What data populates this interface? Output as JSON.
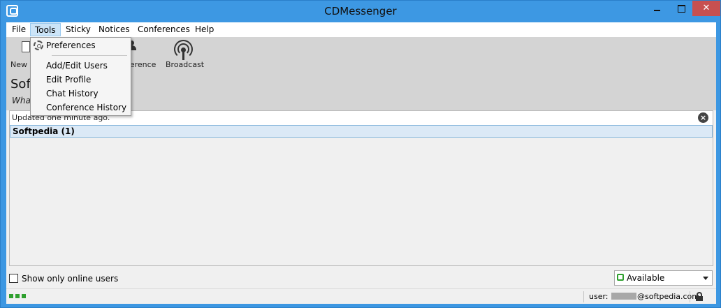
{
  "window": {
    "title": "CDMessenger"
  },
  "menubar": {
    "items": [
      {
        "label": "File"
      },
      {
        "label": "Tools"
      },
      {
        "label": "Sticky"
      },
      {
        "label": "Notices"
      },
      {
        "label": "Conferences"
      },
      {
        "label": "Help"
      }
    ],
    "active": "Tools"
  },
  "tools_menu": {
    "items": [
      {
        "label": "Preferences",
        "icon": "gear-icon"
      },
      {
        "label": "Add/Edit Users"
      },
      {
        "label": "Edit Profile"
      },
      {
        "label": "Chat History"
      },
      {
        "label": "Conference History"
      }
    ]
  },
  "toolbar": {
    "new_label_partial": "New S",
    "conference_label_partial": "nference",
    "broadcast_label": "Broadcast"
  },
  "profile": {
    "name_partial": "Soft",
    "status_partial": "What"
  },
  "users_panel": {
    "updated_text": "Updated one minute ago.",
    "group_label": "Softpedia (1)"
  },
  "footer": {
    "show_online_label": "Show only online users",
    "show_online_checked": false,
    "status_value": "Available",
    "user_prefix": "user:",
    "user_domain": "@softpedia.com"
  },
  "colors": {
    "titlebar": "#3d98e3",
    "close_button": "#c75050",
    "online_green": "#2ea02e",
    "group_row": "#dbe9f6"
  }
}
